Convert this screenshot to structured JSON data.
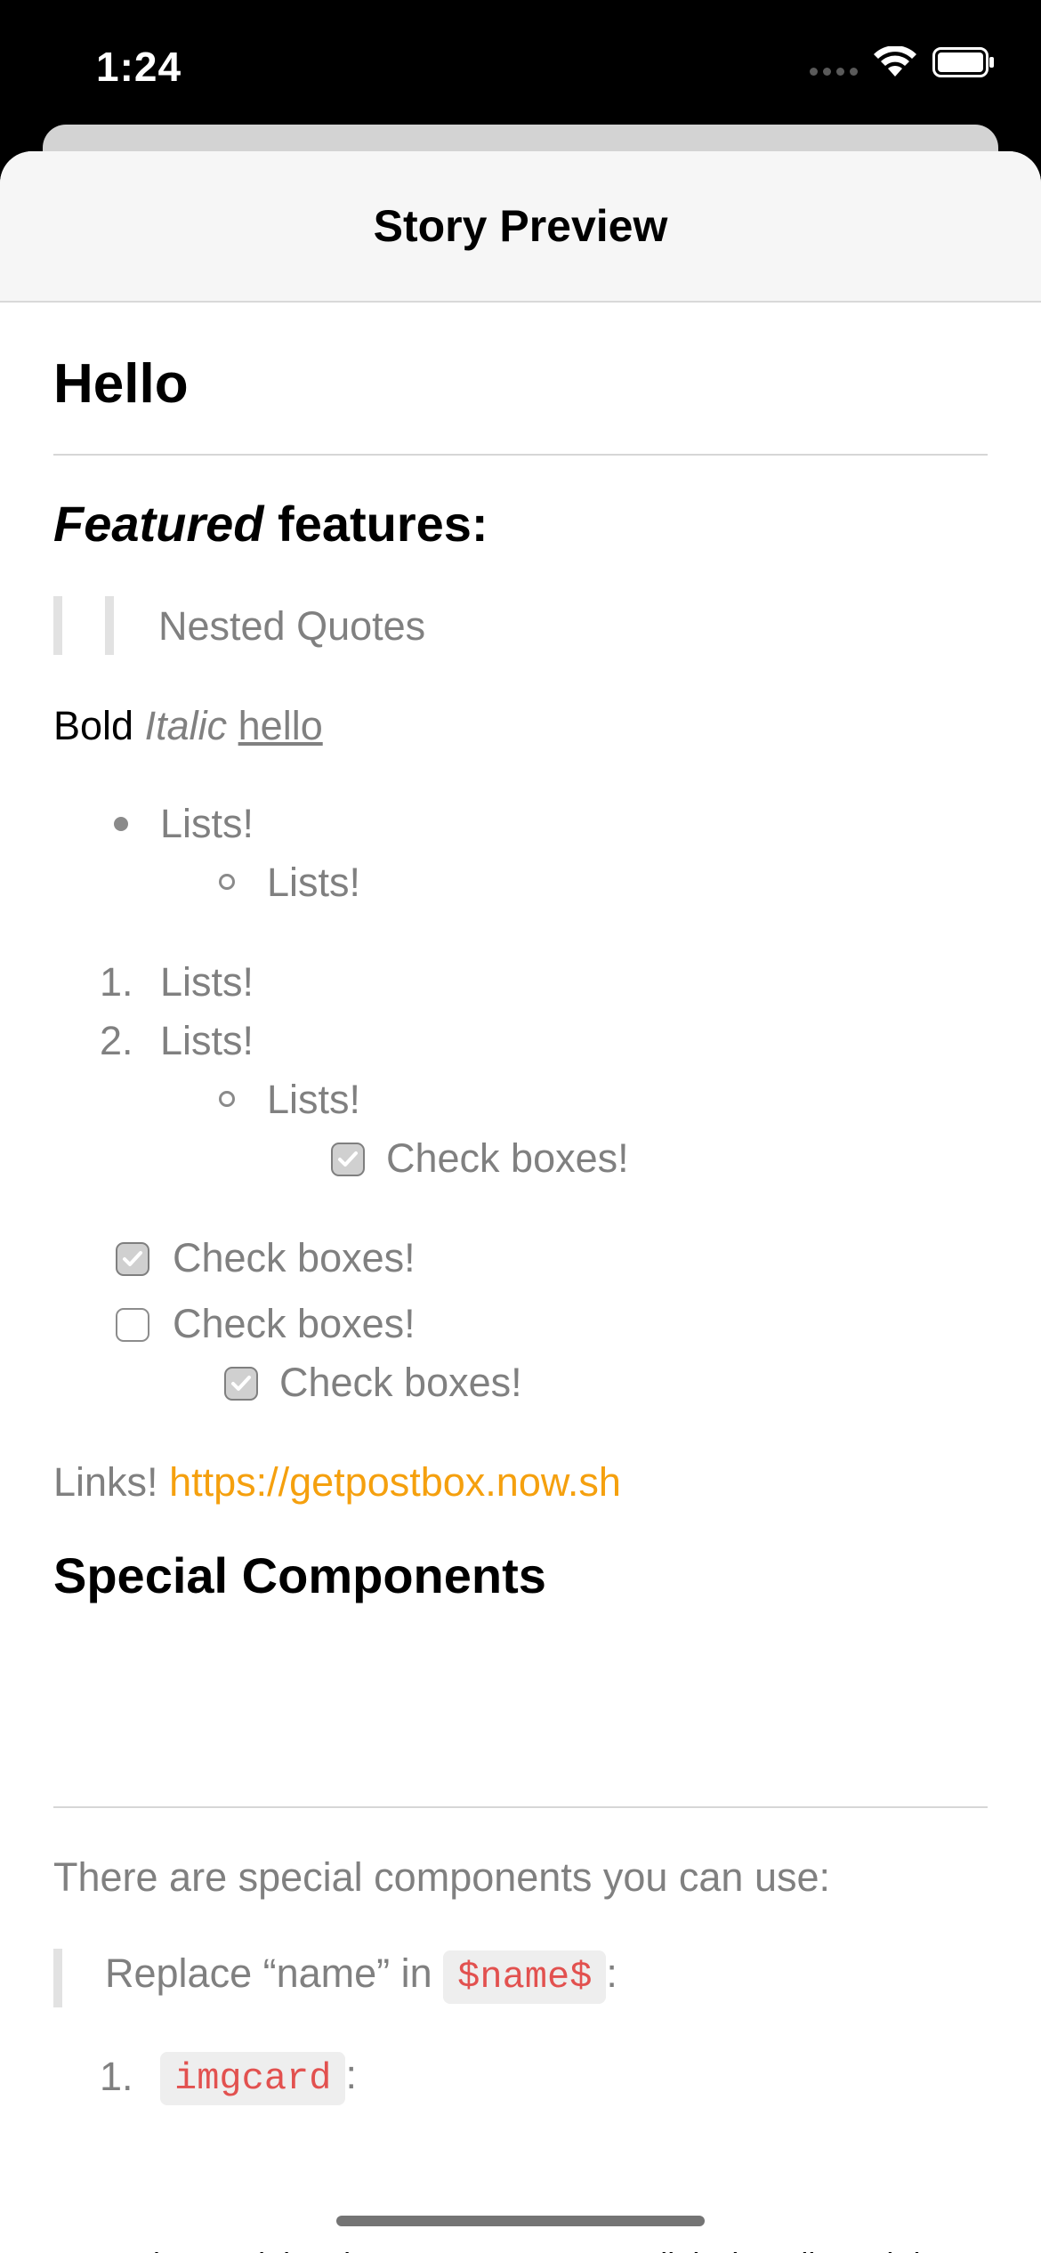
{
  "status_bar": {
    "time": "1:24",
    "icons": [
      "signal-icon",
      "wifi-icon",
      "battery-icon"
    ]
  },
  "nav": {
    "title": "Story Preview"
  },
  "content": {
    "heading": "Hello",
    "subheading_em": "Featured",
    "subheading_rest": " features:",
    "quote": "Nested Quotes",
    "inline_bold": "Bold",
    "inline_italic": "Italic",
    "inline_underline": "hello",
    "bullet_list": [
      "Lists!",
      "Lists!"
    ],
    "ordered_list": [
      {
        "marker": "1.",
        "text": "Lists!"
      },
      {
        "marker": "2.",
        "text": "Lists!"
      }
    ],
    "ordered_nested": "Lists!",
    "ordered_nested_check": {
      "text": "Check boxes!",
      "checked": true
    },
    "checklist": [
      {
        "text": "Check boxes!",
        "checked": true
      },
      {
        "text": "Check boxes!",
        "checked": false
      },
      {
        "text": "Check boxes!",
        "checked": true
      }
    ],
    "links_label": "Links! ",
    "link_url": "https://getpostbox.now.sh",
    "special_heading": "Special Components",
    "special_intro": "There are special components you can use:",
    "replace_text": "Replace “name” in ",
    "replace_code": "$name$",
    "replace_colon": ":",
    "imgcard_marker": "1.",
    "imgcard_code": "imgcard",
    "imgcard_colon": ":",
    "lorem": "Lorem ipsum dolor sit amet, consectetur adipiscing elit, sed do eiusmod tempor."
  },
  "colors": {
    "link": "#f5a00e",
    "code_text": "#e2514f",
    "muted_text": "#808080"
  }
}
